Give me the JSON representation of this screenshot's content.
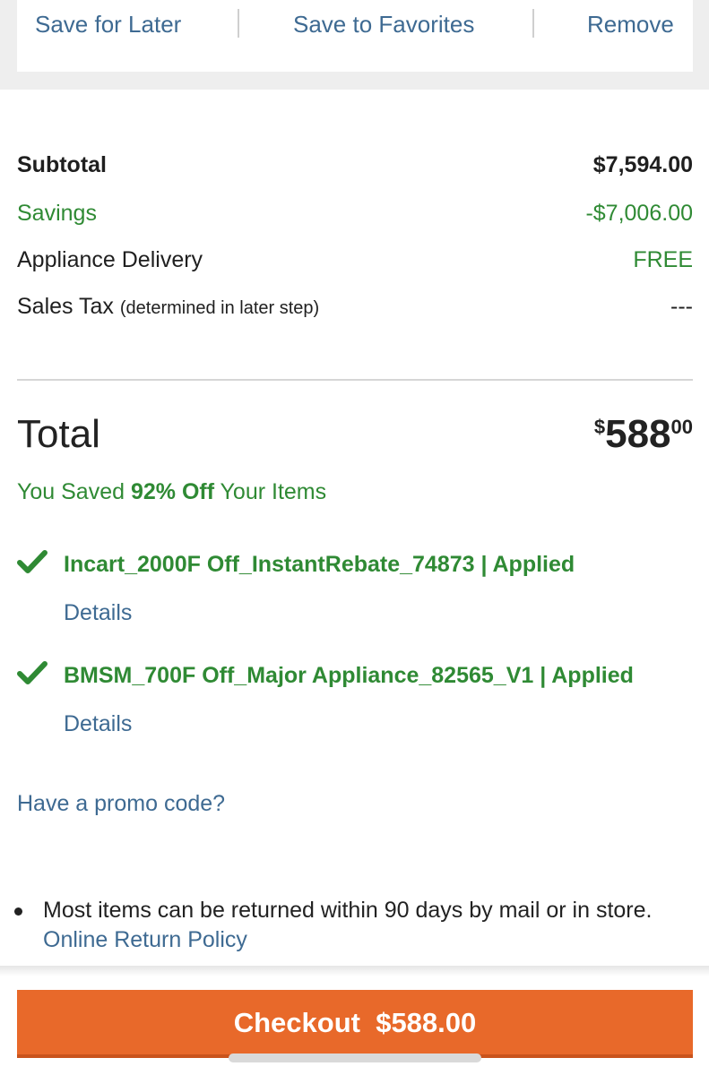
{
  "actions": {
    "save_for_later": "Save for Later",
    "save_to_favorites": "Save to Favorites",
    "remove": "Remove"
  },
  "summary": {
    "subtotal_label": "Subtotal",
    "subtotal_value": "$7,594.00",
    "savings_label": "Savings",
    "savings_value": "-$7,006.00",
    "delivery_label": "Appliance Delivery",
    "delivery_value": "FREE",
    "tax_label": "Sales Tax",
    "tax_note": "(determined in later step)",
    "tax_value": "---"
  },
  "total": {
    "label": "Total",
    "currency": "$",
    "amount": "588",
    "cents": "00"
  },
  "you_saved": {
    "prefix": "You Saved ",
    "percent": "92% Off",
    "suffix": " Your Items"
  },
  "promos": [
    {
      "text": "Incart_2000F Off_InstantRebate_74873 | Applied",
      "details_label": "Details",
      "icon": "check-icon"
    },
    {
      "text": "BMSM_700F Off_Major Appliance_82565_V1 | Applied",
      "details_label": "Details",
      "icon": "check-icon"
    }
  ],
  "promo_code_link": "Have a promo code?",
  "returns": {
    "text": "Most items can be returned within 90 days by mail or in store. ",
    "link": "Online Return Policy"
  },
  "checkout": {
    "label": "Checkout  $588.00"
  },
  "colors": {
    "accent_orange": "#e8692a",
    "savings_green": "#2f8a34",
    "link_blue": "#3e6a92"
  }
}
